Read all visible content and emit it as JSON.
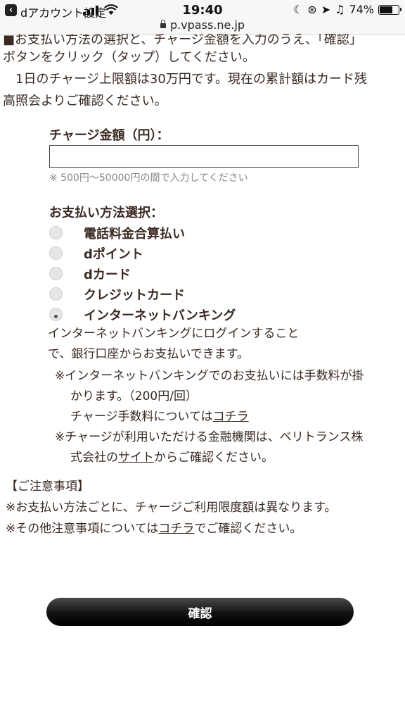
{
  "status_bar": {
    "back_app": "dアカウント設定",
    "time": "19:40",
    "battery": "74%",
    "battery_level": 0.74,
    "url": "p.vpass.ne.jp"
  },
  "intro": {
    "cut_line": "■お支払い方法の選択と、チャージ金額を入力のうえ、「確認」",
    "line1": "ボタンをクリック（タップ）してください。",
    "line2": "　1日のチャージ上限額は30万円です。現在の累計額はカード残",
    "line3": "高照会よりご確認ください。"
  },
  "form": {
    "amount_label": "チャージ金額（円）：",
    "amount_value": "",
    "amount_note": "※ 500円〜50000円の間で入力してください",
    "method_label": "お支払い方法選択：",
    "methods": [
      {
        "label": "電話料金合算払い",
        "selected": false
      },
      {
        "label": "dポイント",
        "selected": false
      },
      {
        "label": "dカード",
        "selected": false
      },
      {
        "label": "クレジットカード",
        "selected": false
      },
      {
        "label": "インターネットバンキング",
        "selected": true
      }
    ],
    "bank_desc_1": "インターネットバンキングにログインすること",
    "bank_desc_2": "で、銀行口座からお支払いできます。",
    "note1_a": "※インターネットバンキングでのお支払いには手数料が掛かります。（200円/回）",
    "note1_b_prefix": "チャージ手数料については",
    "note1_b_link": "コチラ",
    "note2_prefix": "※チャージが利用いただける金融機関は、ベリトランス株式会社の",
    "note2_link": "サイト",
    "note2_suffix": "からご確認ください。"
  },
  "caution": {
    "heading": "【ご注意事項】",
    "line1": "※お支払い方法ごとに、チャージご利用限度額は異なります。",
    "line2_prefix": "※その他注意事項については",
    "line2_link": "コチラ",
    "line2_suffix": "でご確認ください。"
  },
  "confirm_button": "確認"
}
